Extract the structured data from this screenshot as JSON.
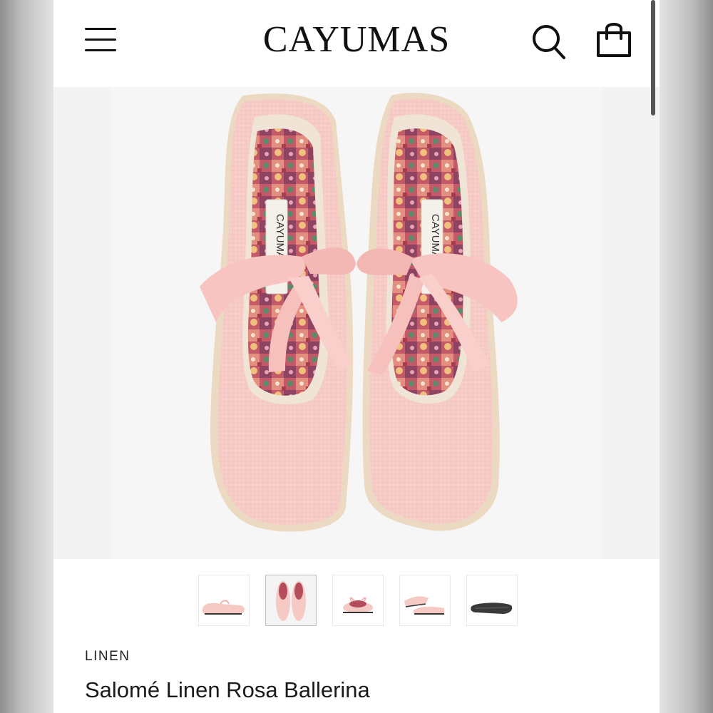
{
  "header": {
    "logo": "CAYUMAS",
    "menu_icon": "hamburger-menu-icon",
    "search_icon": "search-icon",
    "bag_icon": "shopping-bag-icon"
  },
  "gallery": {
    "main_image": "pink linen ballerina shoes with bow, top view",
    "label_text": "CAYUMAS",
    "thumbnails": [
      {
        "name": "side view"
      },
      {
        "name": "top view"
      },
      {
        "name": "front view"
      },
      {
        "name": "pair side view"
      },
      {
        "name": "sole view"
      }
    ],
    "active_index": 1
  },
  "product": {
    "category": "LINEN",
    "title": "Salomé Linen Rosa Ballerina"
  },
  "colors": {
    "shoe": "#f5c9c4",
    "ribbon": "#f7c4c1",
    "insole_dark": "#b54d5c",
    "jute": "#ecd9c2"
  }
}
